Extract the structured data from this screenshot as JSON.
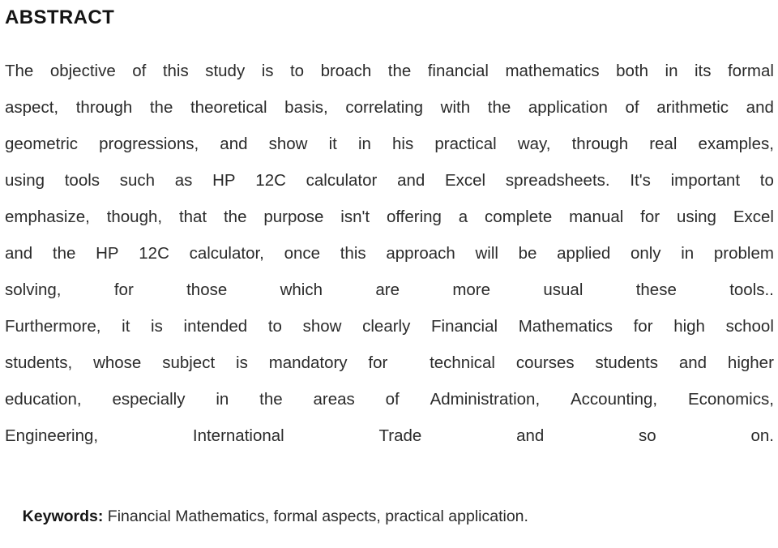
{
  "document": {
    "heading": "ABSTRACT",
    "abstract_lines": [
      [
        "The",
        "objective",
        "of",
        "this",
        "study",
        "is",
        "to",
        "broach",
        "the",
        "financial",
        "mathematics",
        "both",
        "in",
        "its",
        "formal"
      ],
      [
        "aspect,",
        "through",
        "the",
        "theoretical",
        "basis,",
        "correlating",
        "with",
        "the",
        "application",
        "of",
        "arithmetic",
        "and"
      ],
      [
        "geometric",
        "progressions,",
        "and",
        "show",
        "it",
        "in",
        "his",
        "practical",
        "way,",
        "through",
        "real",
        "examples,"
      ],
      [
        "using",
        "tools",
        "such",
        "as",
        "HP",
        "12C",
        "calculator",
        "and",
        "Excel",
        "spreadsheets.",
        "It's",
        "important",
        "to"
      ],
      [
        "emphasize,",
        "though,",
        "that",
        "the",
        "purpose",
        "isn't",
        "offering",
        "a",
        "complete",
        "manual",
        "for",
        "using",
        "Excel"
      ],
      [
        "and",
        "the",
        "HP",
        "12C",
        "calculator,",
        "once",
        "this",
        "approach",
        "will",
        "be",
        "applied",
        "only",
        "in",
        "problem"
      ],
      [
        "solving,",
        "for",
        "those",
        "which",
        "are",
        "more",
        "usual",
        "these",
        "tools.."
      ],
      [
        "Furthermore,",
        "it",
        "is",
        "intended",
        "to",
        "show",
        "clearly",
        "Financial",
        "Mathematics",
        "for",
        "high",
        "school"
      ],
      [
        "students,",
        "whose",
        "subject",
        "is",
        "mandatory",
        "for",
        "",
        "technical",
        "courses",
        "students",
        "and",
        "higher"
      ],
      [
        "education,",
        "especially",
        "in",
        "the",
        "areas",
        "of",
        "Administration,",
        "Accounting,",
        "Economics,"
      ],
      [
        "Engineering,",
        "International",
        "Trade",
        "and",
        "so",
        "on."
      ]
    ],
    "abstract_text": "The objective of this study is to broach the financial mathematics both in its formal aspect, through the theoretical basis, correlating with the application of arithmetic and geometric progressions, and show it in his practical way, through real examples, using tools such as HP 12C calculator and Excel spreadsheets. It's important to emphasize, though, that the purpose isn't offering a complete manual for using Excel and the HP 12C calculator, once this approach will be applied only in problem solving, for those which are more usual these tools.. Furthermore, it is intended to show clearly Financial Mathematics for high school students, whose subject is mandatory for technical courses students and higher education, especially in the areas of Administration, Accounting, Economics, Engineering, International Trade and so on.",
    "keywords_label": "Keywords:",
    "keywords_value": " Financial Mathematics, formal aspects, practical application."
  },
  "style": {
    "text_color": "#2b2b2b",
    "heading_color": "#141414",
    "page_background": "#ffffff"
  }
}
